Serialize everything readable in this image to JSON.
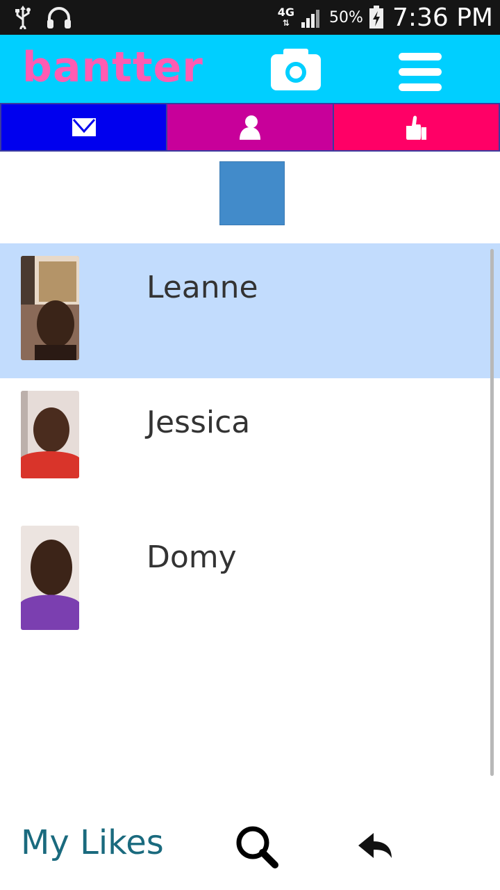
{
  "status_bar": {
    "network_type": "4G",
    "battery_percent": "50%",
    "time": "7:36 PM",
    "icons": [
      "usb-icon",
      "headphones-icon",
      "signal-icon",
      "battery-charging-icon"
    ]
  },
  "header": {
    "logo_text": "bantter",
    "logo_color": "#ff5cb2",
    "background_color": "#00cfff",
    "camera_icon": "camera-icon",
    "menu_icon": "hamburger-menu-icon"
  },
  "tabs": [
    {
      "icon": "envelope-icon",
      "color": "#0000ee"
    },
    {
      "icon": "person-icon",
      "color": "#c8009a"
    },
    {
      "icon": "thumbs-up-icon",
      "color": "#ff0066"
    }
  ],
  "placeholder_color": "#428bca",
  "contacts": [
    {
      "name": "Leanne",
      "selected": true,
      "shirt_color": "#5a3a2a"
    },
    {
      "name": "Jessica",
      "selected": false,
      "shirt_color": "#d9342a"
    },
    {
      "name": "Domy",
      "selected": false,
      "shirt_color": "#7b3fb0"
    }
  ],
  "selected_row_color": "#c2dcfd",
  "bottom_bar": {
    "my_likes_label": "My Likes",
    "search_icon": "search-icon",
    "back_icon": "reply-arrow-icon"
  }
}
